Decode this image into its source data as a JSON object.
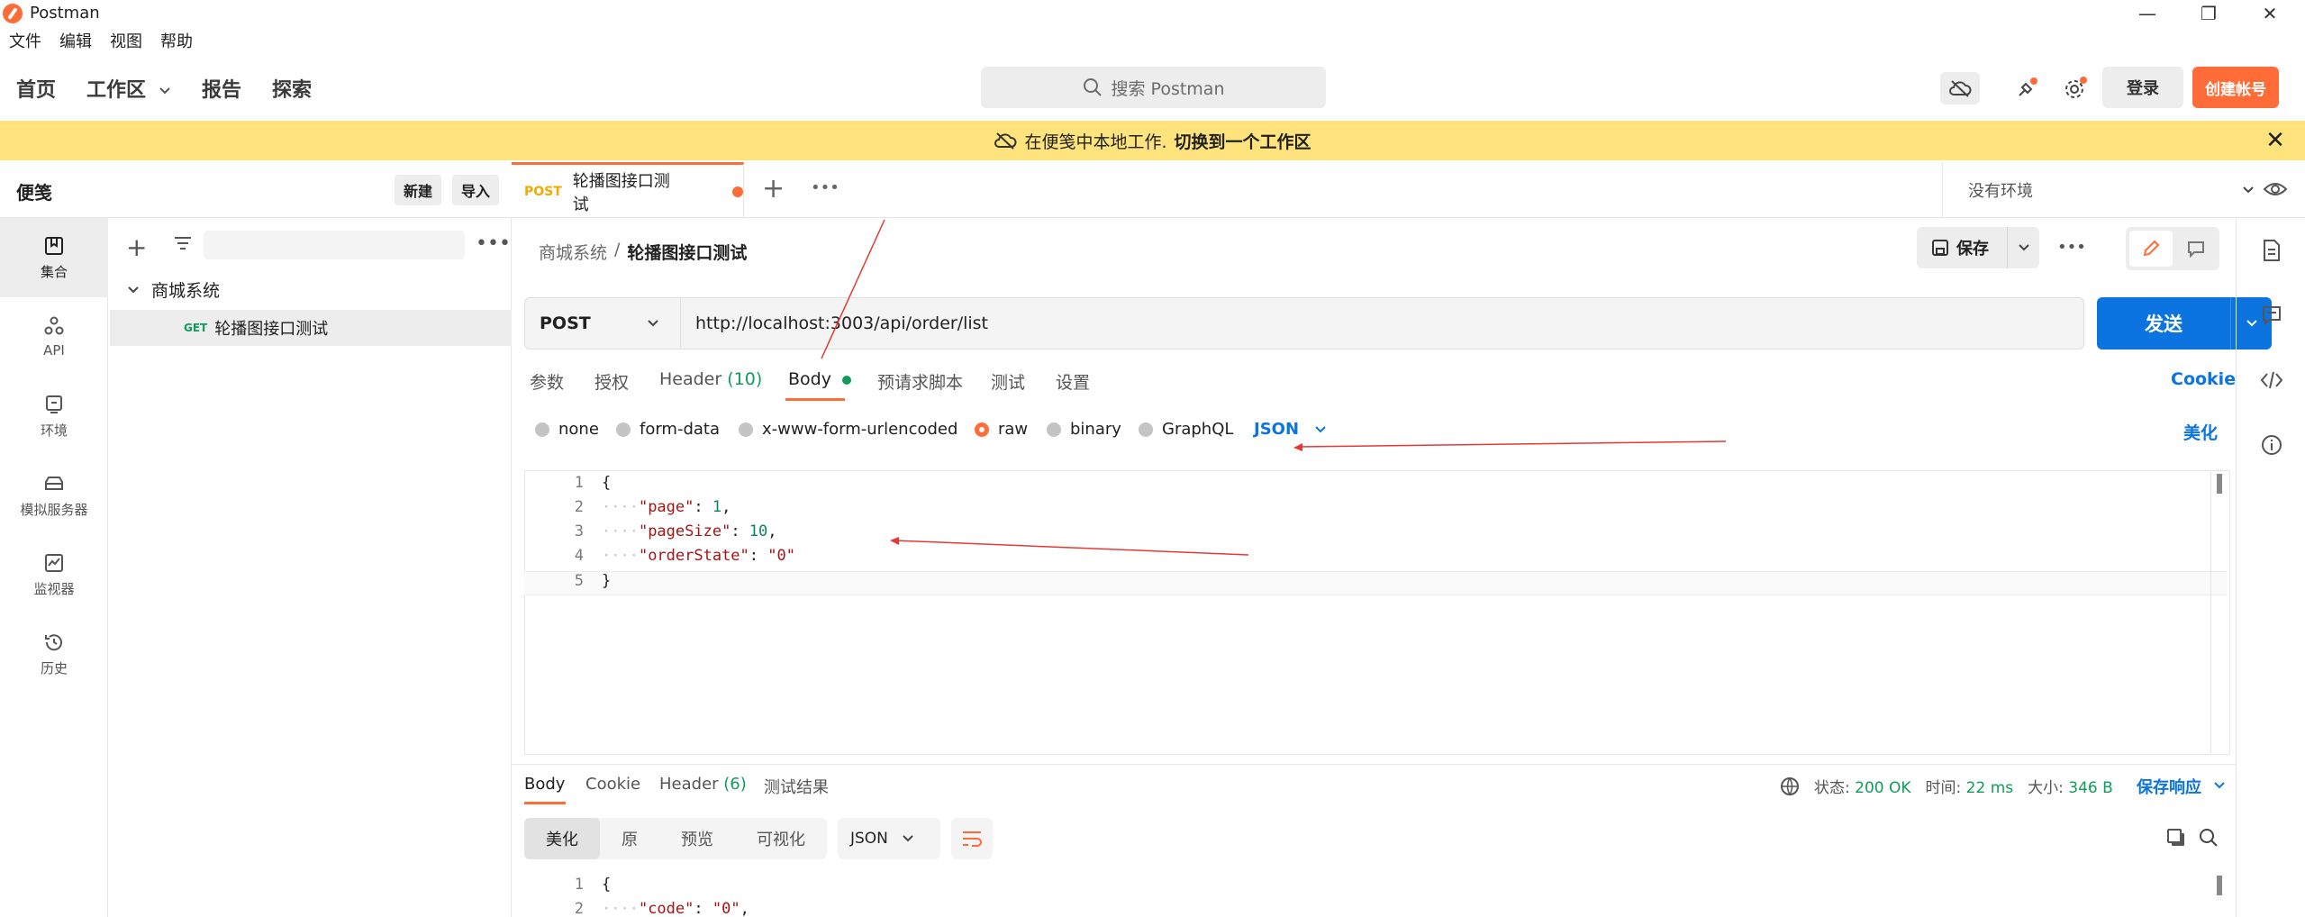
{
  "window": {
    "title": "Postman"
  },
  "menu": [
    "文件",
    "编辑",
    "视图",
    "帮助"
  ],
  "nav": {
    "home": "首页",
    "workspace": "工作区",
    "reports": "报告",
    "explore": "探索"
  },
  "search": {
    "placeholder": "搜索 Postman"
  },
  "header": {
    "login": "登录",
    "signup": "创建帐号"
  },
  "banner": {
    "text": "在便笺中本地工作.",
    "link": "切换到一个工作区"
  },
  "sidebar": {
    "title": "便笺",
    "new_label": "新建",
    "import_label": "导入",
    "rail": [
      {
        "label": "集合",
        "icon": "collections-icon"
      },
      {
        "label": "API",
        "icon": "api-icon"
      },
      {
        "label": "环境",
        "icon": "environment-icon"
      },
      {
        "label": "模拟服务器",
        "icon": "mock-server-icon"
      },
      {
        "label": "监视器",
        "icon": "monitor-icon"
      },
      {
        "label": "历史",
        "icon": "history-icon"
      }
    ],
    "tree": {
      "collection": "商城系统",
      "request_method": "GET",
      "request_name": "轮播图接口测试"
    }
  },
  "tab": {
    "method": "POST",
    "name": "轮播图接口测试"
  },
  "environment": {
    "selected": "没有环境"
  },
  "breadcrumb": {
    "parent": "商城系统",
    "separator": "/",
    "current": "轮播图接口测试"
  },
  "toolbar": {
    "save_label": "保存"
  },
  "request": {
    "method": "POST",
    "url": "http://localhost:3003/api/order/list",
    "send_label": "发送",
    "tabs": {
      "params": "参数",
      "auth": "授权",
      "headers": "Header",
      "headers_count": "(10)",
      "body": "Body",
      "prerequest": "预请求脚本",
      "tests": "测试",
      "settings": "设置"
    },
    "cookie_label": "Cookie",
    "body_types": [
      "none",
      "form-data",
      "x-www-form-urlencoded",
      "raw",
      "binary",
      "GraphQL"
    ],
    "body_format": "JSON",
    "beautify_label": "美化",
    "body_lines": [
      {
        "num": "1",
        "text": "{"
      },
      {
        "num": "2",
        "key": "\"page\"",
        "value": "1",
        "type": "number"
      },
      {
        "num": "3",
        "key": "\"pageSize\"",
        "value": "10",
        "type": "number"
      },
      {
        "num": "4",
        "key": "\"orderState\"",
        "value": "\"0\"",
        "type": "string"
      },
      {
        "num": "5",
        "text": "}"
      }
    ]
  },
  "response": {
    "tabs": {
      "body": "Body",
      "cookie": "Cookie",
      "headers": "Header",
      "headers_count": "(6)",
      "results": "测试结果"
    },
    "status_label": "状态:",
    "status_value": "200 OK",
    "time_label": "时间:",
    "time_value": "22 ms",
    "size_label": "大小:",
    "size_value": "346 B",
    "save_label": "保存响应",
    "views": [
      "美化",
      "原",
      "预览",
      "可视化"
    ],
    "format": "JSON",
    "lines": [
      {
        "num": "1",
        "text": "{"
      },
      {
        "num": "2",
        "key": "\"code\"",
        "value": "\"0\""
      }
    ]
  },
  "colors": {
    "accent": "#ff6c37",
    "primary": "#0c74e0",
    "banner": "#ffe47e",
    "success": "#0f9d58"
  }
}
